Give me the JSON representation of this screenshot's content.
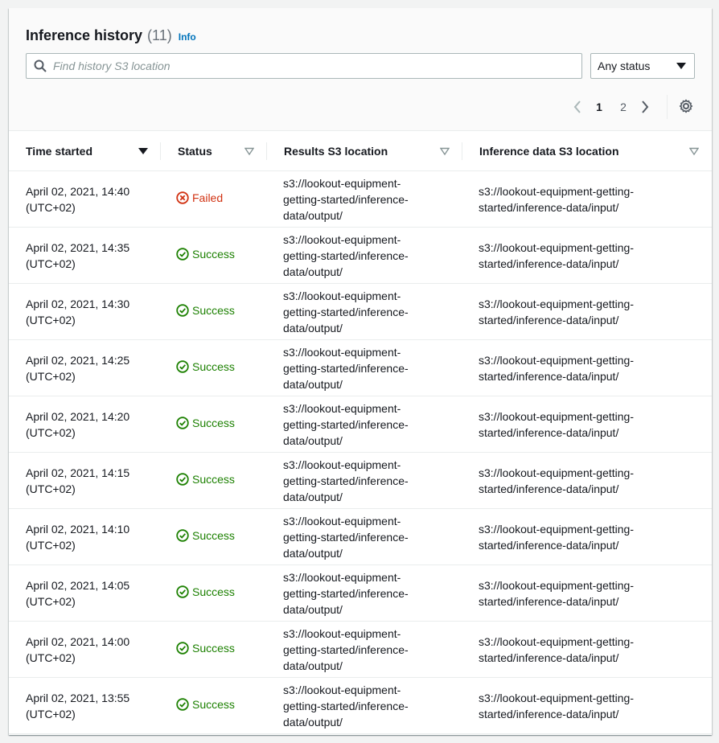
{
  "header": {
    "title": "Inference history",
    "count": "(11)",
    "info_label": "Info"
  },
  "search": {
    "placeholder": "Find history S3 location"
  },
  "status_filter": {
    "selected": "Any status"
  },
  "pagination": {
    "pages": [
      "1",
      "2"
    ],
    "current_page": "1"
  },
  "table": {
    "columns": [
      "Time started",
      "Status",
      "Results S3 location",
      "Inference data S3 location"
    ],
    "rows": [
      {
        "time": "April 02, 2021, 14:40",
        "tz": "(UTC+02)",
        "status": "Failed",
        "status_type": "failed",
        "results": [
          "s3://lookout-equipment-",
          "getting-started/inference-",
          "data/output/"
        ],
        "input": [
          "s3://lookout-equipment-getting-",
          "started/inference-data/input/"
        ]
      },
      {
        "time": "April 02, 2021, 14:35",
        "tz": "(UTC+02)",
        "status": "Success",
        "status_type": "success",
        "results": [
          "s3://lookout-equipment-",
          "getting-started/inference-",
          "data/output/"
        ],
        "input": [
          "s3://lookout-equipment-getting-",
          "started/inference-data/input/"
        ]
      },
      {
        "time": "April 02, 2021, 14:30",
        "tz": "(UTC+02)",
        "status": "Success",
        "status_type": "success",
        "results": [
          "s3://lookout-equipment-",
          "getting-started/inference-",
          "data/output/"
        ],
        "input": [
          "s3://lookout-equipment-getting-",
          "started/inference-data/input/"
        ]
      },
      {
        "time": "April 02, 2021, 14:25",
        "tz": "(UTC+02)",
        "status": "Success",
        "status_type": "success",
        "results": [
          "s3://lookout-equipment-",
          "getting-started/inference-",
          "data/output/"
        ],
        "input": [
          "s3://lookout-equipment-getting-",
          "started/inference-data/input/"
        ]
      },
      {
        "time": "April 02, 2021, 14:20",
        "tz": "(UTC+02)",
        "status": "Success",
        "status_type": "success",
        "results": [
          "s3://lookout-equipment-",
          "getting-started/inference-",
          "data/output/"
        ],
        "input": [
          "s3://lookout-equipment-getting-",
          "started/inference-data/input/"
        ]
      },
      {
        "time": "April 02, 2021, 14:15",
        "tz": "(UTC+02)",
        "status": "Success",
        "status_type": "success",
        "results": [
          "s3://lookout-equipment-",
          "getting-started/inference-",
          "data/output/"
        ],
        "input": [
          "s3://lookout-equipment-getting-",
          "started/inference-data/input/"
        ]
      },
      {
        "time": "April 02, 2021, 14:10",
        "tz": "(UTC+02)",
        "status": "Success",
        "status_type": "success",
        "results": [
          "s3://lookout-equipment-",
          "getting-started/inference-",
          "data/output/"
        ],
        "input": [
          "s3://lookout-equipment-getting-",
          "started/inference-data/input/"
        ]
      },
      {
        "time": "April 02, 2021, 14:05",
        "tz": "(UTC+02)",
        "status": "Success",
        "status_type": "success",
        "results": [
          "s3://lookout-equipment-",
          "getting-started/inference-",
          "data/output/"
        ],
        "input": [
          "s3://lookout-equipment-getting-",
          "started/inference-data/input/"
        ]
      },
      {
        "time": "April 02, 2021, 14:00",
        "tz": "(UTC+02)",
        "status": "Success",
        "status_type": "success",
        "results": [
          "s3://lookout-equipment-",
          "getting-started/inference-",
          "data/output/"
        ],
        "input": [
          "s3://lookout-equipment-getting-",
          "started/inference-data/input/"
        ]
      },
      {
        "time": "April 02, 2021, 13:55",
        "tz": "(UTC+02)",
        "status": "Success",
        "status_type": "success",
        "results": [
          "s3://lookout-equipment-",
          "getting-started/inference-",
          "data/output/"
        ],
        "input": [
          "s3://lookout-equipment-getting-",
          "started/inference-data/input/"
        ]
      }
    ]
  },
  "colors": {
    "success": "#1d8102",
    "failed": "#d13212",
    "link": "#0073bb"
  }
}
